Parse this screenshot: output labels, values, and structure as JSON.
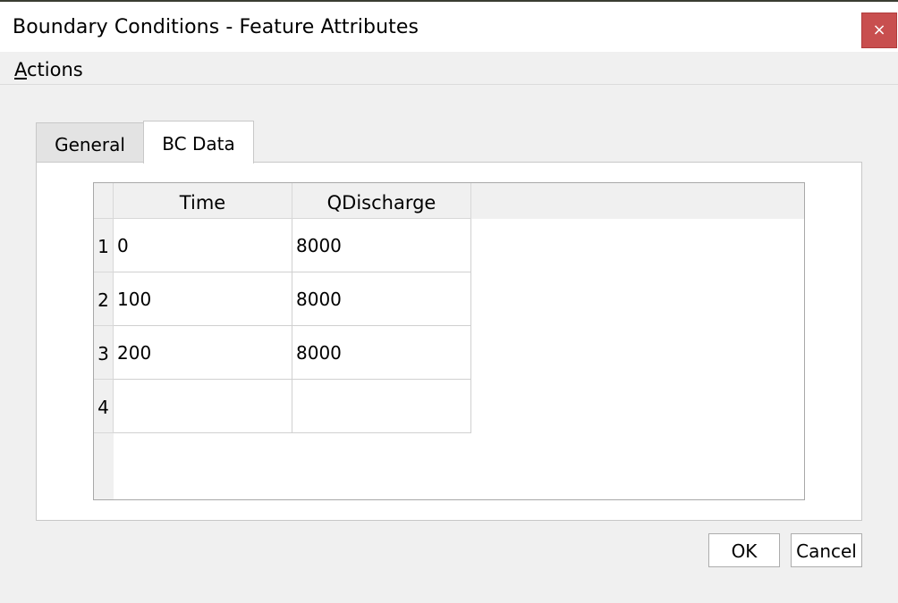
{
  "window": {
    "title": "Boundary Conditions - Feature Attributes",
    "close_glyph": "×"
  },
  "menu": {
    "actions_accel": "A",
    "actions_rest": "ctions"
  },
  "tabs": [
    {
      "label": "General",
      "selected": false
    },
    {
      "label": "BC Data",
      "selected": true
    }
  ],
  "table": {
    "columns": [
      "Time",
      "QDischarge"
    ],
    "rows": [
      {
        "num": "1",
        "time": "0",
        "q": "8000"
      },
      {
        "num": "2",
        "time": "100",
        "q": "8000"
      },
      {
        "num": "3",
        "time": "200",
        "q": "8000"
      },
      {
        "num": "4",
        "time": "",
        "q": ""
      }
    ]
  },
  "buttons": {
    "ok": "OK",
    "cancel": "Cancel"
  },
  "colors": {
    "close_button": "#c84f4f",
    "dialog_background": "#f0f0f0"
  }
}
